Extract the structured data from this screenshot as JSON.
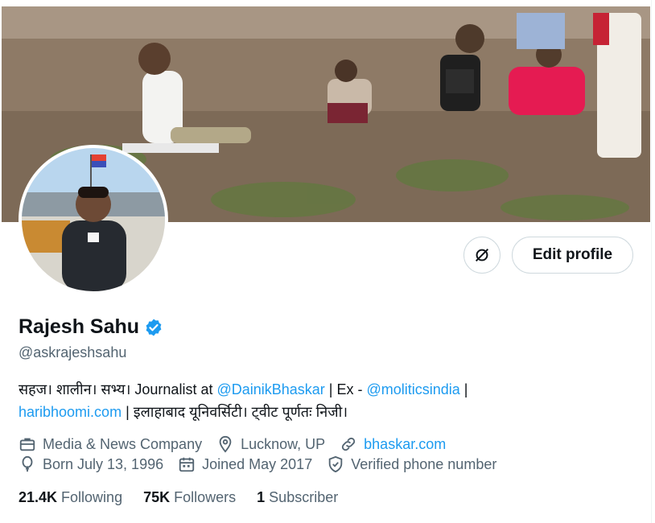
{
  "profile": {
    "name": "Rajesh Sahu",
    "handle": "@askrajeshsahu",
    "bio": {
      "part1": "सहज। शालीन। सभ्य। Journalist at ",
      "mention1": "@DainikBhaskar",
      "part2": " | Ex - ",
      "mention2": "@moliticsindia",
      "part3": " |",
      "link1": "haribhoomi.com",
      "part4": " | इलाहाबाद यूनिवर्सिटी। ट्वीट पूर्णतः निजी।"
    },
    "category": "Media & News Company",
    "location": "Lucknow, UP",
    "website": "bhaskar.com",
    "born": "Born July 13, 1996",
    "joined": "Joined May 2017",
    "verified_phone": "Verified phone number"
  },
  "actions": {
    "edit_profile": "Edit profile"
  },
  "stats": {
    "following_count": "21.4K",
    "following_label": "Following",
    "followers_count": "75K",
    "followers_label": "Followers",
    "subscriber_count": "1",
    "subscriber_label": "Subscriber"
  },
  "colors": {
    "accent": "#1d9bf0",
    "muted": "#536471",
    "text": "#0f1419",
    "border": "#cfd9de"
  },
  "icons": [
    "briefcase-icon",
    "location-pin-icon",
    "link-icon",
    "balloon-icon",
    "calendar-icon",
    "shield-check-icon",
    "verified-badge-icon",
    "lens-slash-icon"
  ]
}
